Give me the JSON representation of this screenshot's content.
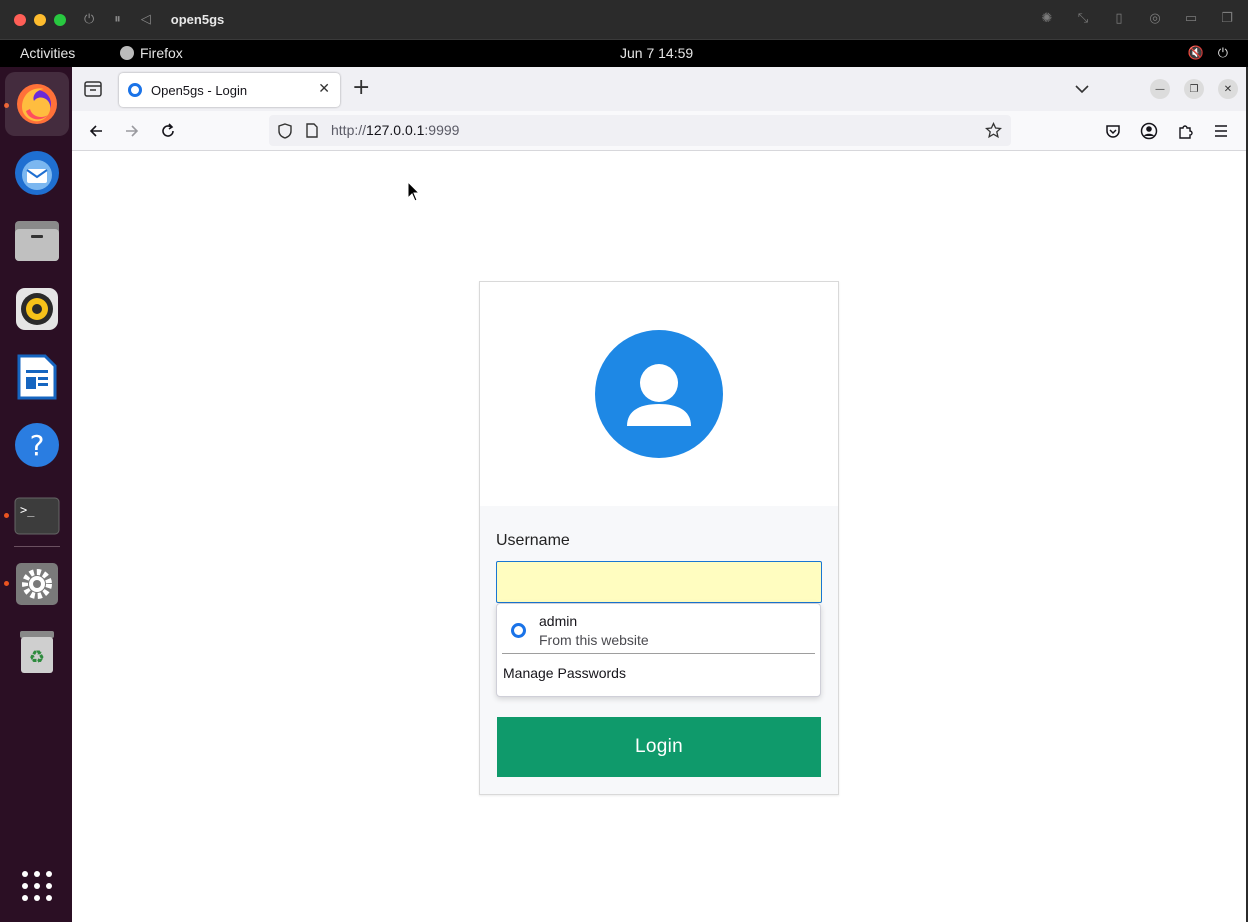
{
  "vm": {
    "title": "open5gs"
  },
  "gnome": {
    "activities": "Activities",
    "app_name": "Firefox",
    "clock": "Jun 7  14:59"
  },
  "dock": {
    "items": [
      "Firefox",
      "Thunderbird",
      "Files",
      "Rhythmbox",
      "LibreOffice Writer",
      "Help",
      "Terminal",
      "Settings",
      "Trash",
      "Show Applications"
    ]
  },
  "browser": {
    "tab_title": "Open5gs - Login",
    "url_prefix": "http://",
    "url_host": "127.0.0.1",
    "url_port": ":9999"
  },
  "login": {
    "username_label": "Username",
    "username_value": "",
    "autocomplete": {
      "username": "admin",
      "source": "From this website",
      "manage": "Manage Passwords"
    },
    "button_label": "Login"
  },
  "colors": {
    "accent_blue": "#1e88e5",
    "login_green": "#0f9a6b",
    "autofill_yellow": "#fffdc0",
    "dock_bg": "#2b0f24"
  }
}
